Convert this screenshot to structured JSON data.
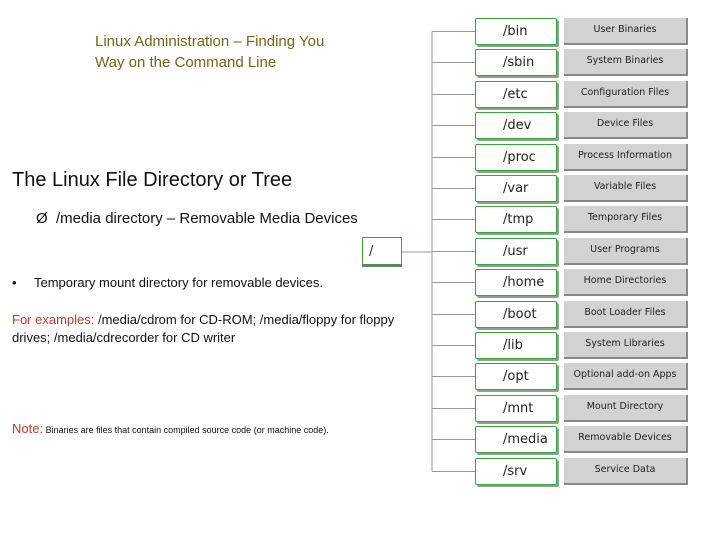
{
  "header": {
    "line1": "Linux Administration – Finding You",
    "line2": "Way on the Command Line"
  },
  "title": "The Linux File Directory or Tree",
  "subheading": {
    "marker": "Ø",
    "text": "/media directory – Removable Media Devices"
  },
  "root_label": "/",
  "bullet": {
    "marker": "•",
    "text": "Temporary mount directory for removable devices."
  },
  "examples": {
    "label": "For examples:",
    "text": " /media/cdrom for CD-ROM; /media/floppy for floppy drives; /media/cdrecorder for CD writer"
  },
  "note": {
    "label": "Note:",
    "text": " Binaries are files that contain compiled source code (or machine code)."
  },
  "directories": [
    {
      "name": "/bin",
      "description": "User Binaries"
    },
    {
      "name": "/sbin",
      "description": "System Binaries"
    },
    {
      "name": "/etc",
      "description": "Configuration Files"
    },
    {
      "name": "/dev",
      "description": "Device Files"
    },
    {
      "name": "/proc",
      "description": "Process Information"
    },
    {
      "name": "/var",
      "description": "Variable Files"
    },
    {
      "name": "/tmp",
      "description": "Temporary Files"
    },
    {
      "name": "/usr",
      "description": "User Programs"
    },
    {
      "name": "/home",
      "description": "Home Directories"
    },
    {
      "name": "/boot",
      "description": "Boot Loader Files"
    },
    {
      "name": "/lib",
      "description": "System Libraries"
    },
    {
      "name": "/opt",
      "description": "Optional add-on Apps"
    },
    {
      "name": "/mnt",
      "description": "Mount Directory"
    },
    {
      "name": "/media",
      "description": "Removable Devices"
    },
    {
      "name": "/srv",
      "description": "Service Data"
    }
  ]
}
